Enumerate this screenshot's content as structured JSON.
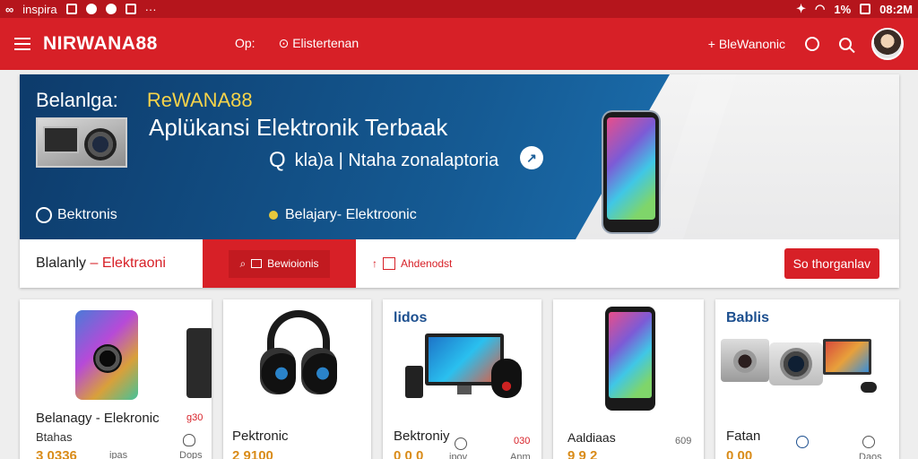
{
  "status_bar": {
    "carrier": "inspira",
    "time": "08:2M",
    "battery": "1%"
  },
  "app_bar": {
    "brand": "NIRWANA88",
    "nav_left": "Op:",
    "nav_mid": "Elistertenan",
    "nav_right": "+ BleWanonic"
  },
  "hero": {
    "title_prefix": "Belanlga:",
    "title_accent": "ReWANA88",
    "subtitle": "Aplükansi Elektronik Terbaak",
    "search_text": "kla)a | Ntaha zonalaptoria",
    "brand_small": "Bektronis",
    "tagline": "Belajary- Elektroonic"
  },
  "hero_bar": {
    "label_dark": "Blalanly",
    "label_red": "– Elektraoni",
    "tab_search_label": "Bewioionis",
    "filter_label": "Ahdenodst",
    "cta_label": "So thorganlav"
  },
  "products": [
    {
      "name": "Belanagy - Elekronic",
      "sub": "Btahas",
      "price": "3 0336",
      "meta": "ipas",
      "badge": "g30",
      "action": "Dops"
    },
    {
      "name": "Pektronic",
      "price": "2 9100"
    },
    {
      "tag": "lidos",
      "name": "Bektroniy",
      "price": "0 0 0",
      "meta": "ipov",
      "badge": "030",
      "action": "Anm"
    },
    {
      "name": "Aaldiaas",
      "price": "9 9 2",
      "badge": "609"
    },
    {
      "tag": "Bablis",
      "name": "Fatan",
      "price": "0 00",
      "action": "Daos"
    }
  ],
  "colors": {
    "primary": "#d72027",
    "status_bar": "#b5151c",
    "banner": "#155a93",
    "accent_yellow": "#f6d34a",
    "price": "#d98b18"
  }
}
